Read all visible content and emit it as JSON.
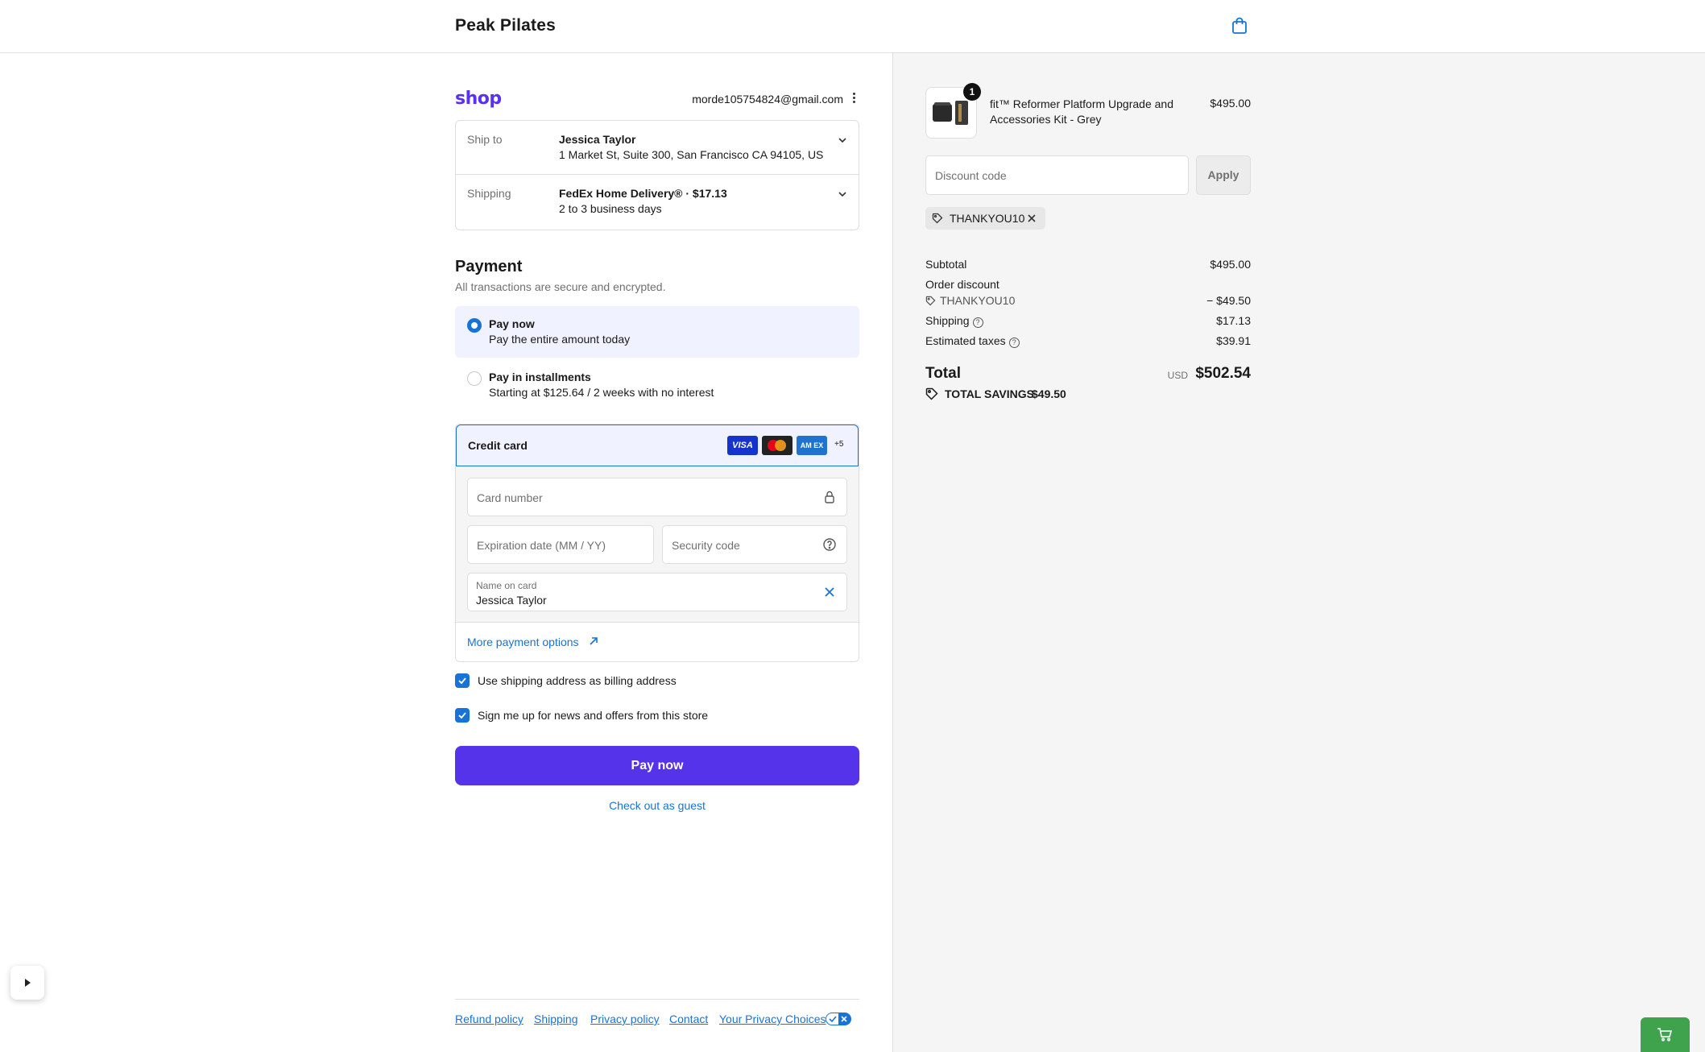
{
  "header": {
    "store_name": "Peak Pilates",
    "cart_icon": "shopping-bag-icon"
  },
  "account": {
    "shop_logo": "shop",
    "email": "morde105754824@gmail.com",
    "menu_icon": "kebab-menu-icon"
  },
  "summary": {
    "ship_to": {
      "label": "Ship to",
      "name": "Jessica Taylor",
      "address": "1 Market St, Suite 300, San Francisco CA 94105, US"
    },
    "shipping": {
      "label": "Shipping",
      "method": "FedEx Home Delivery® · $17.13",
      "eta": "2 to 3 business days"
    }
  },
  "payment": {
    "title": "Payment",
    "subtitle": "All transactions are secure and encrypted.",
    "options": [
      {
        "label": "Pay now",
        "description": "Pay the entire amount today",
        "selected": true
      },
      {
        "label": "Pay in installments",
        "description": "Starting at $125.64 / 2 weeks with no interest",
        "selected": false
      }
    ],
    "credit_card": {
      "label": "Credit card",
      "brands": [
        "VISA",
        "Mastercard",
        "AMEX"
      ],
      "brand_visa": "VISA",
      "brand_amex": "AM EX",
      "more_brands": "+5",
      "card_number_placeholder": "Card number",
      "expiration_placeholder": "Expiration date (MM / YY)",
      "security_placeholder": "Security code",
      "name_label": "Name on card",
      "name_value": "Jessica Taylor"
    },
    "more_options": "More payment options",
    "billing_checkbox": "Use shipping address as billing address",
    "news_checkbox": "Sign me up for news and offers from this store",
    "pay_button": "Pay now",
    "guest_link": "Check out as guest"
  },
  "footer": {
    "links": [
      "Refund policy",
      "Shipping",
      "Privacy policy",
      "Contact",
      "Your Privacy Choices"
    ]
  },
  "order": {
    "product": {
      "quantity": "1",
      "title": "fit™ Reformer Platform Upgrade and Accessories Kit - Grey",
      "price": "$495.00"
    },
    "discount_placeholder": "Discount code",
    "apply_label": "Apply",
    "applied_code": "THANKYOU10",
    "subtotal_label": "Subtotal",
    "subtotal_value": "$495.00",
    "order_discount_label": "Order discount",
    "order_discount_code": "THANKYOU10",
    "order_discount_value": "− $49.50",
    "shipping_label": "Shipping",
    "shipping_value": "$17.13",
    "taxes_label": "Estimated taxes",
    "taxes_value": "$39.91",
    "total_label": "Total",
    "total_currency": "USD",
    "total_value": "$502.54",
    "savings_label": "TOTAL SAVINGS",
    "savings_value": "$49.50"
  },
  "colors": {
    "accent": "#5433eb",
    "link": "#1773d8",
    "shop_brand": "#5a31f4",
    "cart_fab": "#3fa34d"
  }
}
